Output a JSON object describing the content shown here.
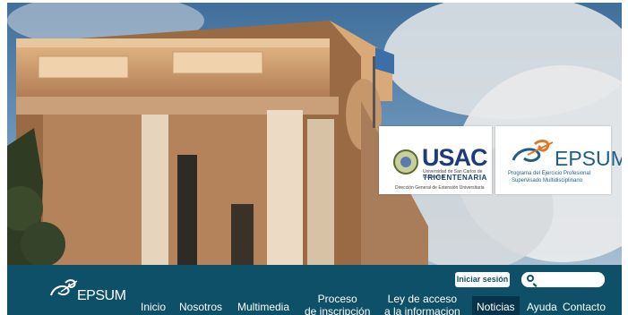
{
  "hero": {
    "usac_logo": {
      "word": "USAC",
      "subtitle": "Universidad de San Carlos de Guatemala",
      "tricentenaria": "TRICENTENARIA",
      "department": "Dirección General de Extensión Universitaria"
    },
    "epsum_logo": {
      "word": "EPSUM",
      "line1": "Programa del Ejercicio Profesional",
      "line2": "Supervisado Multidisciplinario"
    }
  },
  "navbar": {
    "logo_text": "EPSUM",
    "login_label": "Iniciar sesión",
    "search_placeholder": "",
    "items": [
      {
        "line1": "Inicio",
        "line2": ""
      },
      {
        "line1": "Nosotros",
        "line2": ""
      },
      {
        "line1": "Multimedia",
        "line2": ""
      },
      {
        "line1": "Proceso",
        "line2": "de inscripción"
      },
      {
        "line1": "Ley de acceso",
        "line2": "a la informacion"
      },
      {
        "line1": "Noticias",
        "line2": ""
      },
      {
        "line1": "Ayuda",
        "line2": ""
      },
      {
        "line1": "Contacto",
        "line2": ""
      }
    ],
    "colors": {
      "bar": "#0d5068",
      "active": "#07344a",
      "text": "#ffffff"
    }
  }
}
